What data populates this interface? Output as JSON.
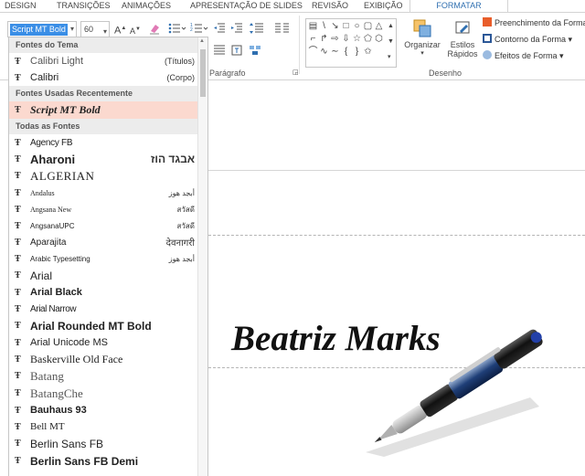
{
  "tabs": [
    {
      "label": "DESIGN",
      "active": false
    },
    {
      "label": "TRANSIÇÕES",
      "active": false
    },
    {
      "label": "ANIMAÇÕES",
      "active": false
    },
    {
      "label": "APRESENTAÇÃO DE SLIDES",
      "active": false
    },
    {
      "label": "REVISÃO",
      "active": false
    },
    {
      "label": "EXIBIÇÃO",
      "active": false
    },
    {
      "label": "FORMATAR",
      "active": true
    }
  ],
  "ribbon": {
    "font_name": "Script MT Bold",
    "font_size": "60",
    "paragraph_label": "Parágrafo",
    "drawing_label": "Desenho",
    "arrange_label": "Organizar",
    "quick_styles_label": "Estilos\nRápidos",
    "shape_fill_label": "Preenchimento da Forma",
    "shape_outline_label": "Contorno da Forma",
    "shape_effects_label": "Efeitos de Forma",
    "accent_color": "#2f6fb0",
    "fill_color": "#e85d2a",
    "outline_color": "#2b5797"
  },
  "font_dropdown": {
    "sections": [
      {
        "header": "Fontes do Tema",
        "items": [
          {
            "name": "Calibri Light",
            "sample": "(Títulos)"
          },
          {
            "name": "Calibri",
            "sample": "(Corpo)"
          }
        ]
      },
      {
        "header": "Fontes Usadas Recentemente",
        "items": [
          {
            "name": "Script MT Bold",
            "sample": "",
            "highlighted": true
          }
        ]
      },
      {
        "header": "Todas as Fontes",
        "items": [
          {
            "name": "Agency FB",
            "sample": ""
          },
          {
            "name": "Aharoni",
            "sample": "אבגד הוז"
          },
          {
            "name": "ALGERIAN",
            "sample": ""
          },
          {
            "name": "Andalus",
            "sample": "أبجد هوز"
          },
          {
            "name": "Angsana New",
            "sample": "สวัสดี"
          },
          {
            "name": "AngsanaUPC",
            "sample": "สวัสดี"
          },
          {
            "name": "Aparajita",
            "sample": "देवनागरी"
          },
          {
            "name": "Arabic Typesetting",
            "sample": "أبجد هوز"
          },
          {
            "name": "Arial",
            "sample": ""
          },
          {
            "name": "Arial Black",
            "sample": ""
          },
          {
            "name": "Arial Narrow",
            "sample": ""
          },
          {
            "name": "Arial Rounded MT Bold",
            "sample": ""
          },
          {
            "name": "Arial Unicode MS",
            "sample": ""
          },
          {
            "name": "Baskerville Old Face",
            "sample": ""
          },
          {
            "name": "Batang",
            "sample": ""
          },
          {
            "name": "BatangChe",
            "sample": ""
          },
          {
            "name": "Bauhaus 93",
            "sample": ""
          },
          {
            "name": "Bell MT",
            "sample": ""
          },
          {
            "name": "Berlin Sans FB",
            "sample": ""
          },
          {
            "name": "Berlin Sans FB Demi",
            "sample": ""
          }
        ]
      }
    ]
  },
  "slide": {
    "signature_text": "Beatriz Marks",
    "guide_line_color": "#b5b5b5"
  }
}
